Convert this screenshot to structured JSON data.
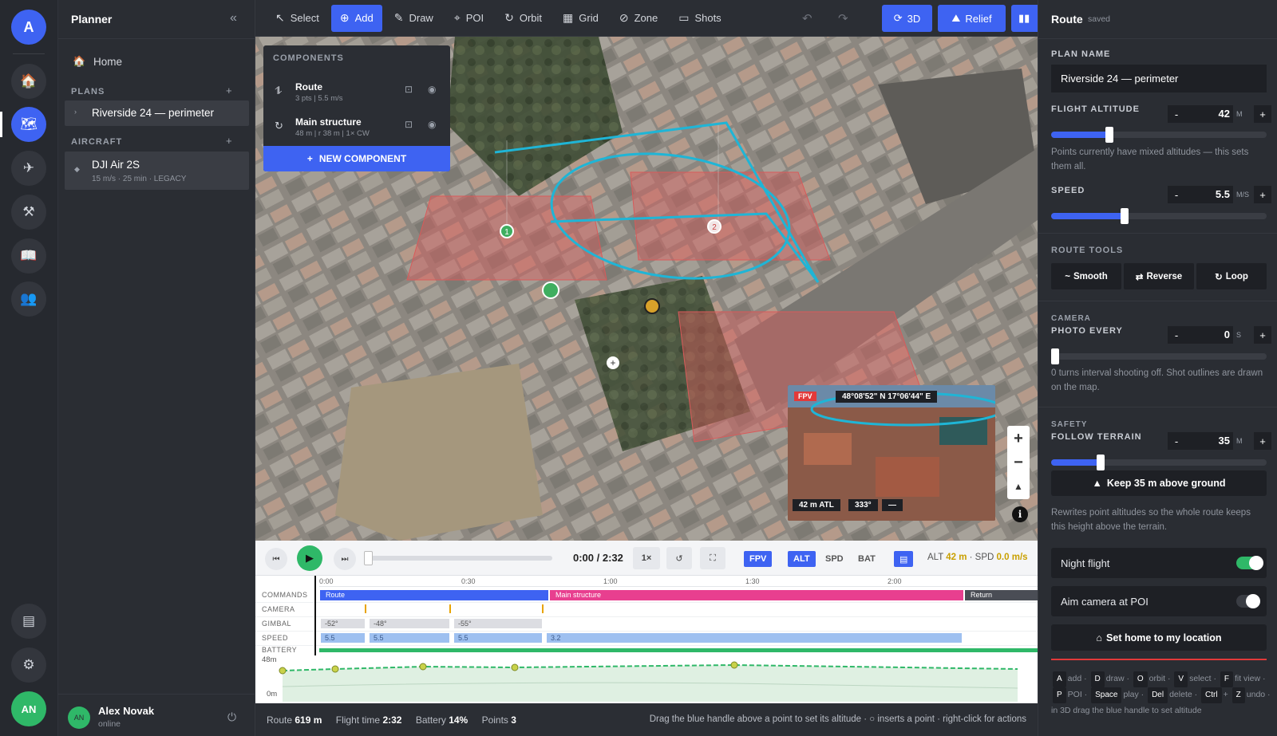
{
  "rail": {
    "logo": "A",
    "avatar": "AN"
  },
  "left": {
    "title": "Planner",
    "collapse": "«",
    "home": "Home",
    "plans_label": "PLANS",
    "plan_item": "Riverside 24 — perimeter",
    "aircraft_label": "AIRCRAFT",
    "aircraft_name": "DJI Air 2S",
    "aircraft_meta": "15 m/s · 25 min · LEGACY",
    "add": "+",
    "user_name": "Alex Novak",
    "user_status": "online",
    "user_initials": "AN"
  },
  "toolbar": {
    "tools": [
      {
        "label": "Select",
        "icon": "cursor-icon",
        "glyph": "↖"
      },
      {
        "label": "Add",
        "icon": "add-point-icon",
        "glyph": "⊕"
      },
      {
        "label": "Draw",
        "icon": "pencil-icon",
        "glyph": "✎"
      },
      {
        "label": "POI",
        "icon": "target-icon",
        "glyph": "⌖"
      },
      {
        "label": "Orbit",
        "icon": "orbit-icon",
        "glyph": "↻"
      },
      {
        "label": "Grid",
        "icon": "grid-icon",
        "glyph": "▦"
      },
      {
        "label": "Zone",
        "icon": "zone-icon",
        "glyph": "⊘"
      },
      {
        "label": "Shots",
        "icon": "shots-icon",
        "glyph": "▭"
      }
    ],
    "undo": "↶",
    "redo": "↷",
    "view_3d": "3D",
    "relief": "Relief"
  },
  "components": {
    "header": "COMPONENTS",
    "items": [
      {
        "name": "Route",
        "meta": "3 pts | 5.5 m/s"
      },
      {
        "name": "Main structure",
        "meta": "48 m | r 38 m | 1× CW"
      }
    ],
    "new_label": "NEW COMPONENT"
  },
  "map": {
    "markers": [
      "1",
      "2"
    ],
    "fpv_badge": "FPV",
    "fpv_coords": "48°08'52\" N 17°06'44\" E",
    "fpv_alt": "42 m ATL",
    "fpv_heading": "333°",
    "fpv_dash": "—",
    "zoom_in": "+",
    "zoom_out": "−",
    "compass": "▲",
    "info": "i"
  },
  "player": {
    "time": "0:00 / 2:32",
    "rate": "1×",
    "chips": [
      "FPV",
      "ALT",
      "SPD",
      "BAT"
    ],
    "alt_label": "ALT",
    "alt_value": "42 m",
    "spd_label": "· SPD",
    "spd_value": "0.0 m/s",
    "progress": 0.0
  },
  "timeline": {
    "ticks": [
      "0:00",
      "0:30",
      "1:00",
      "1:30",
      "2:00"
    ],
    "rows": [
      "COMMANDS",
      "CAMERA",
      "GIMBAL",
      "SPEED",
      "BATTERY"
    ],
    "commands": [
      "Route",
      "Main structure",
      "Return"
    ],
    "gimbal": [
      "-52°",
      "-48°",
      "-55°"
    ],
    "speed": [
      "5.5",
      "5.5",
      "5.5",
      "3.2"
    ],
    "alt_top": "48m",
    "alt_bottom": "0m"
  },
  "status": {
    "route_label": "Route",
    "route_value": "619 m",
    "flight_label": "Flight time",
    "flight_value": "2:32",
    "battery_label": "Battery",
    "battery_value": "14%",
    "points_label": "Points",
    "points_value": "3",
    "hint": "Drag the blue handle above a point to set its altitude · ○ inserts a point · right-click for actions"
  },
  "right": {
    "title": "Route",
    "saved": "saved",
    "plan_name_label": "PLAN NAME",
    "plan_name": "Riverside 24 — perimeter",
    "altitude_label": "FLIGHT ALTITUDE",
    "altitude_value": "42",
    "altitude_unit": "M",
    "altitude_fraction": 0.27,
    "altitude_help": "Points currently have mixed altitudes — this sets them all.",
    "speed_label": "SPEED",
    "speed_value": "5.5",
    "speed_unit": "M/S",
    "speed_fraction": 0.34,
    "route_tools_label": "ROUTE TOOLS",
    "smooth": "Smooth",
    "reverse": "Reverse",
    "loop": "Loop",
    "camera_label": "CAMERA",
    "photo_label": "PHOTO EVERY",
    "photo_value": "0",
    "photo_unit": "S",
    "photo_fraction": 0.0,
    "photo_help": "0 turns interval shooting off. Shot outlines are drawn on the map.",
    "safety_label": "SAFETY",
    "terrain_label": "FOLLOW TERRAIN",
    "terrain_value": "35",
    "terrain_unit": "M",
    "terrain_fraction": 0.23,
    "terrain_button": "Keep 35 m above ground",
    "terrain_help": "Rewrites point altitudes so the whole route keeps this height above the terrain.",
    "night_flight": "Night flight",
    "night_on": true,
    "aim_camera": "Aim camera at POI",
    "aim_on": false,
    "set_home": "Set home to my location",
    "minus": "-",
    "plus": "+",
    "shortcuts": [
      {
        "key": "A",
        "desc": "add ·"
      },
      {
        "key": "D",
        "desc": "draw ·"
      },
      {
        "key": "O",
        "desc": "orbit ·"
      },
      {
        "key": "V",
        "desc": "select ·"
      },
      {
        "key": "F",
        "desc": "fit view ·"
      },
      {
        "key": "P",
        "desc": "POI ·"
      },
      {
        "key": "Space",
        "desc": "play ·"
      },
      {
        "key": "Del",
        "desc": "delete ·"
      },
      {
        "key": "Ctrl",
        "desc": "+"
      },
      {
        "key": "Z",
        "desc": "undo · in 3D drag the blue handle to set altitude"
      }
    ]
  },
  "colors": {
    "accent": "#3e63f2",
    "route_line": "#1fb5d6",
    "zone_fill": "#d95a5a",
    "commands_route": "#3e63f2",
    "commands_structure": "#e83f8f",
    "commands_return": "#4a4d55",
    "battery": "#2fb868"
  }
}
